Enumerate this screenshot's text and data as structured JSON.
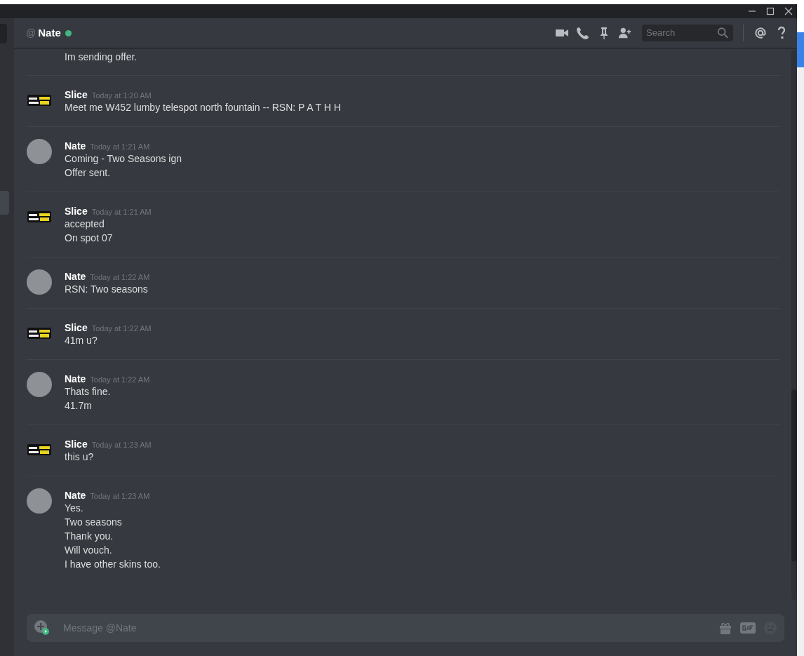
{
  "header": {
    "at_sign": "@",
    "name": "Nate",
    "online": true,
    "search": {
      "placeholder": "Search"
    }
  },
  "messages": [
    {
      "kind": "continuation",
      "lines": [
        "Im sending offer."
      ]
    },
    {
      "kind": "group",
      "avatar": {
        "kind": "logo"
      },
      "author": "Slice",
      "timestamp": "Today at 1:20 AM",
      "lines": [
        "Meet me W452 lumby telespot north fountain -- RSN: P A T H H"
      ]
    },
    {
      "kind": "group",
      "avatar": {
        "kind": "photo"
      },
      "author": "Nate",
      "timestamp": "Today at 1:21 AM",
      "lines": [
        "Coming - Two Seasons ign",
        "Offer sent."
      ]
    },
    {
      "kind": "group",
      "avatar": {
        "kind": "logo"
      },
      "author": "Slice",
      "timestamp": "Today at 1:21 AM",
      "lines": [
        "accepted",
        "On spot 07"
      ]
    },
    {
      "kind": "group",
      "avatar": {
        "kind": "photo"
      },
      "author": "Nate",
      "timestamp": "Today at 1:22 AM",
      "lines": [
        "RSN: Two seasons"
      ]
    },
    {
      "kind": "group",
      "avatar": {
        "kind": "logo"
      },
      "author": "Slice",
      "timestamp": "Today at 1:22 AM",
      "lines": [
        "41m u?"
      ]
    },
    {
      "kind": "group",
      "avatar": {
        "kind": "photo"
      },
      "author": "Nate",
      "timestamp": "Today at 1:22 AM",
      "lines": [
        "Thats fine.",
        "41.7m"
      ]
    },
    {
      "kind": "group",
      "avatar": {
        "kind": "logo"
      },
      "author": "Slice",
      "timestamp": "Today at 1:23 AM",
      "lines": [
        "this u?"
      ]
    },
    {
      "kind": "group",
      "avatar": {
        "kind": "photo"
      },
      "author": "Nate",
      "timestamp": "Today at 1:23 AM",
      "lines": [
        "Yes.",
        "Two seasons",
        "Thank you.",
        "Will vouch.",
        "I have other skins too."
      ]
    }
  ],
  "composer": {
    "placeholder": "Message @Nate"
  }
}
